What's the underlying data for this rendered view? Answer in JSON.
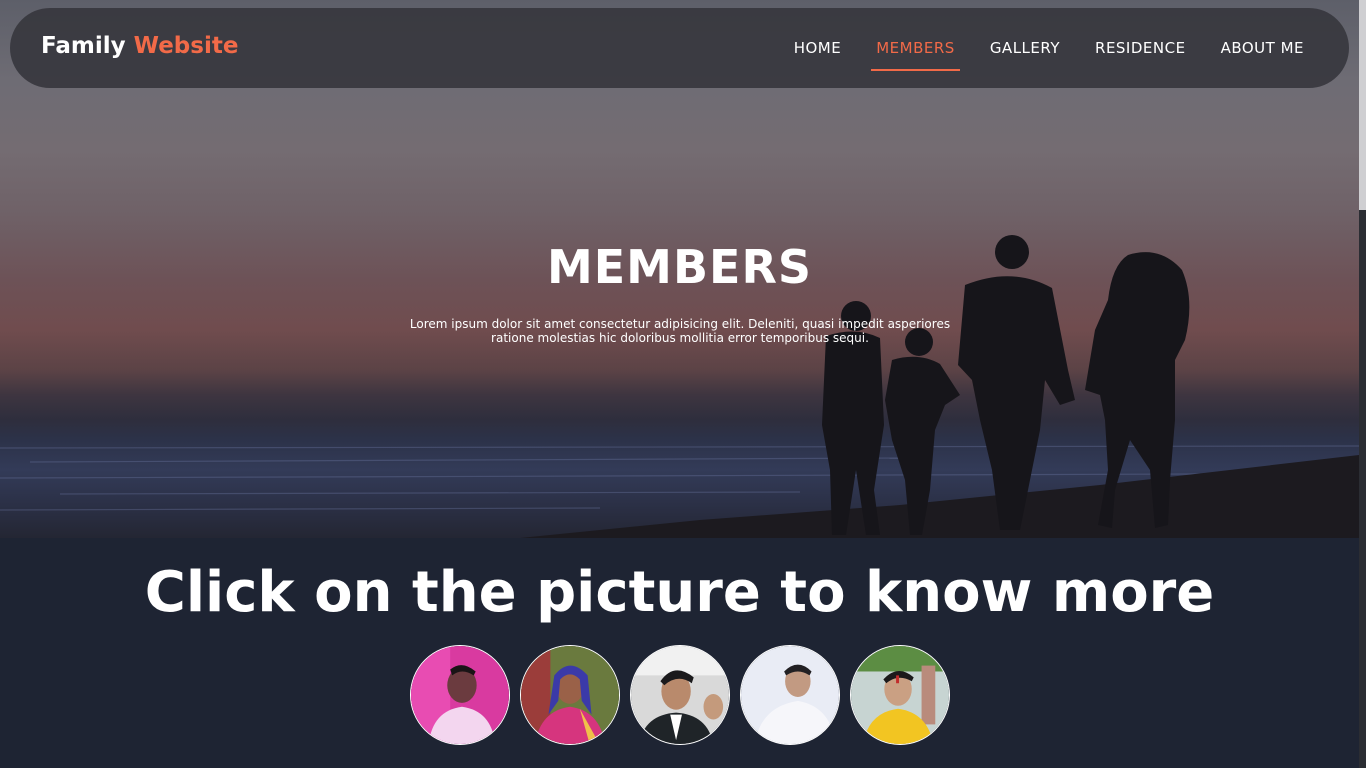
{
  "nav": {
    "logo_main": "Family",
    "logo_accent": "Website",
    "links": [
      {
        "label": "HOME"
      },
      {
        "label": "MEMBERS",
        "active": true
      },
      {
        "label": "GALLERY"
      },
      {
        "label": "RESIDENCE"
      },
      {
        "label": "ABOUT ME"
      }
    ]
  },
  "hero": {
    "title": "MEMBERS",
    "description": "Lorem ipsum dolor sit amet consectetur adipisicing elit. Deleniti, quasi impedit asperiores ratione molestias hic doloribus mollitia error temporibus sequi."
  },
  "members_section": {
    "heading": "Click on the picture to know more",
    "avatars": [
      {
        "icon": "member-photo-1"
      },
      {
        "icon": "member-photo-2"
      },
      {
        "icon": "member-photo-3"
      },
      {
        "icon": "member-photo-4"
      },
      {
        "icon": "member-photo-5"
      }
    ]
  },
  "colors": {
    "accent": "#f26a48",
    "navbar_bg": "#37373e",
    "section_bg": "#1e2433",
    "text": "#ffffff"
  }
}
